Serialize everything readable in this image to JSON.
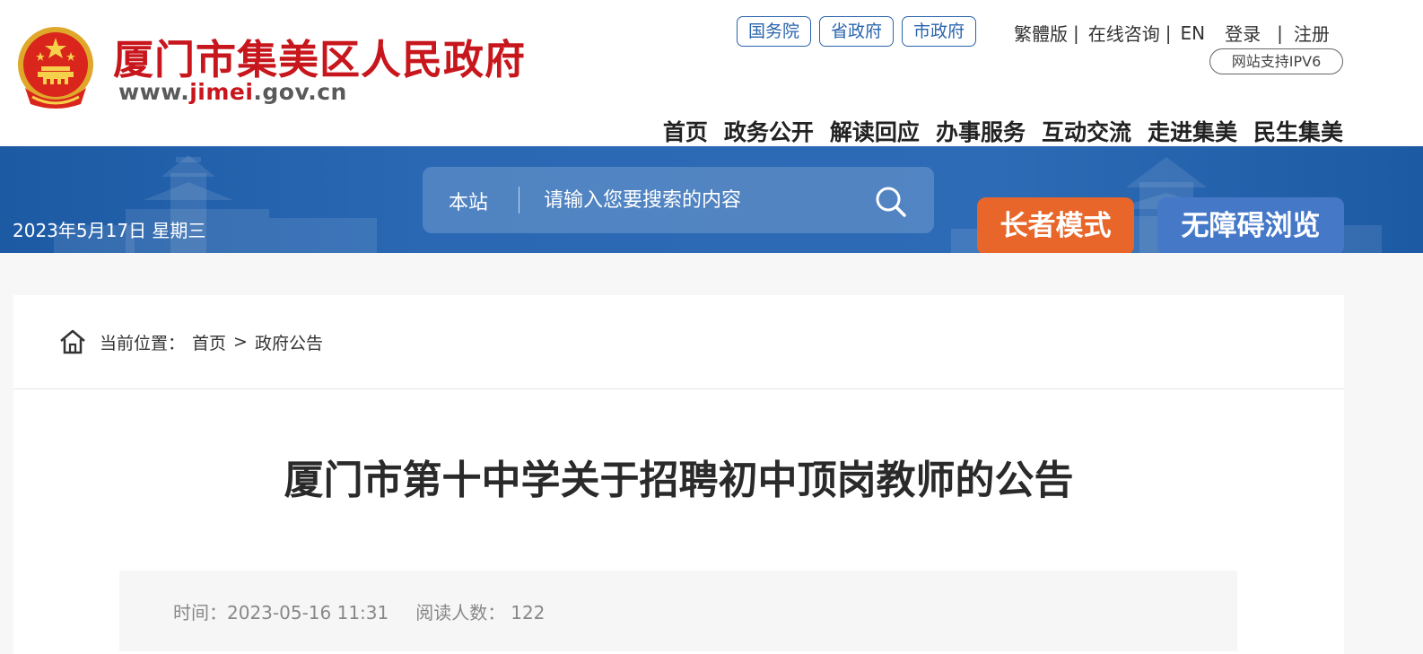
{
  "header": {
    "site_name": "厦门市集美区人民政府",
    "url_prefix": "www.",
    "url_highlight": "jimei",
    "url_suffix": ".gov.cn",
    "gov_links": [
      "国务院",
      "省政府",
      "市政府"
    ],
    "top_links": {
      "traditional": "繁體版",
      "consult": "在线咨询",
      "english": "EN",
      "login": "登录",
      "register": "注册",
      "sep": "|"
    },
    "ipv6_badge": "网站支持IPV6",
    "nav": [
      "首页",
      "政务公开",
      "解读回应",
      "办事服务",
      "互动交流",
      "走进集美",
      "民生集美"
    ]
  },
  "banner": {
    "date": "2023年5月17日 星期三",
    "search_scope": "本站",
    "search_placeholder": "请输入您要搜索的内容",
    "elder_mode": "长者模式",
    "accessibility": "无障碍浏览"
  },
  "content": {
    "breadcrumb_label": "当前位置：",
    "breadcrumb_home": "首页",
    "breadcrumb_sep": ">",
    "breadcrumb_current": "政府公告",
    "title": "厦门市第十中学关于招聘初中顶岗教师的公告",
    "meta": {
      "time_label": "时间：",
      "time_value": "2023-05-16 11:31",
      "views_label": "阅读人数：",
      "views_value": "122"
    }
  },
  "colors": {
    "brand_red": "#c8161d",
    "banner_blue": "#2a68b4",
    "link_blue": "#2a64ad",
    "elder_orange": "#e8662a",
    "access_blue": "#4678c8"
  }
}
